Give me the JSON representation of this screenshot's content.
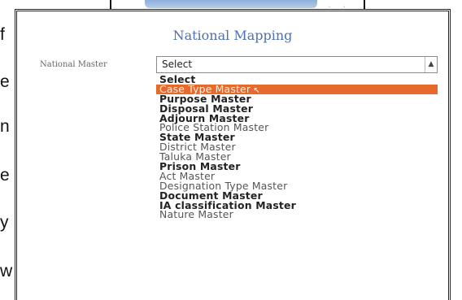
{
  "background_fragments": [
    "f",
    "e",
    "n",
    "e",
    "y",
    "w"
  ],
  "page": {
    "title": "National Mapping",
    "field_label": "National Master",
    "select_value": "Select"
  },
  "dropdown": {
    "options": [
      "Select",
      "Case Type Master",
      "Purpose Master",
      "Disposal Master",
      "Adjourn Master",
      "Police Station Master",
      "State Master",
      "District Master",
      "Taluka Master",
      "Prison Master",
      "Act Master",
      "Designation Type Master",
      "Document Master",
      "IA classification Master",
      "Nature Master"
    ],
    "highlighted_index": 1
  },
  "colors": {
    "title": "#4e6fb0",
    "highlight": "#e56a2b"
  },
  "icons": {
    "select_arrow": "chevron-down-icon",
    "cursor": "mouse-cursor-icon"
  }
}
